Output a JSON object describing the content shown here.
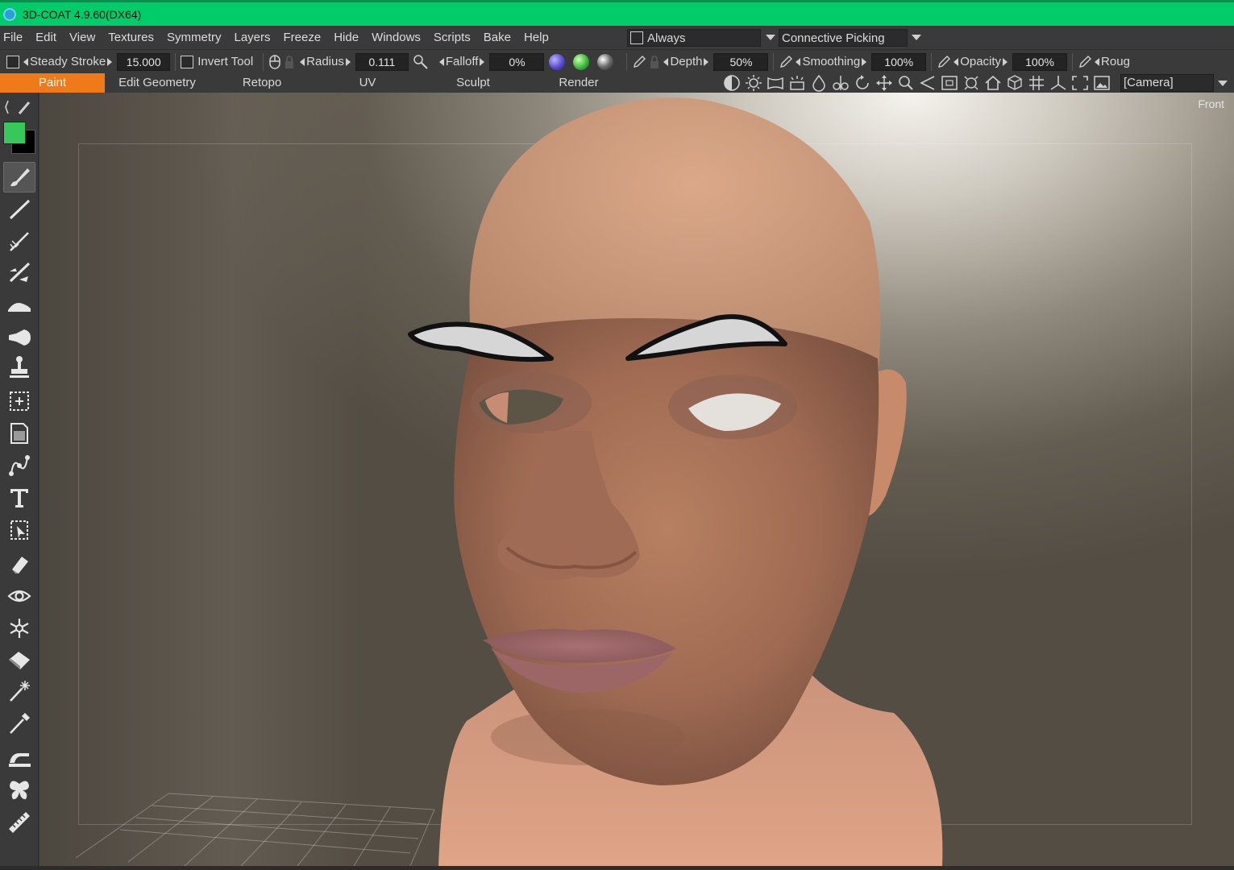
{
  "app": {
    "title": "3D-COAT 4.9.60(DX64)",
    "title_bar_color": "#00cc6a"
  },
  "menu": {
    "items": [
      "File",
      "Edit",
      "View",
      "Textures",
      "Symmetry",
      "Layers",
      "Freeze",
      "Hide",
      "Windows",
      "Scripts",
      "Bake",
      "Help"
    ],
    "always_label": "Always",
    "picking_label": "Connective  Picking"
  },
  "toolbar": {
    "steady_stroke_label": "Steady  Stroke",
    "steady_stroke_value": "15.000",
    "invert_tool_label": "Invert  Tool",
    "radius_label": "Radius",
    "radius_value": "0.111",
    "falloff_label": "Falloff",
    "falloff_value": "0%",
    "depth_label": "Depth",
    "depth_value": "50%",
    "smoothing_label": "Smoothing",
    "smoothing_value": "100%",
    "opacity_label": "Opacity",
    "opacity_value": "100%",
    "roughness_label": "Roug"
  },
  "rooms": {
    "tabs": [
      "Paint",
      "Edit  Geometry",
      "Retopo",
      "UV",
      "Sculpt",
      "Render"
    ],
    "active": "Paint",
    "active_color": "#f07a1a",
    "camera_label": "[Camera]"
  },
  "colors": {
    "primary": "#36c95a",
    "secondary": "#000000"
  },
  "viewport": {
    "view_label": "Front"
  },
  "tools": [
    "select-arrow-icon",
    "brush-icon",
    "line-icon",
    "spline-brush-icon",
    "fill-brush-icon",
    "smudge-icon",
    "blur-icon",
    "stamp-icon",
    "frame-icon",
    "page-icon",
    "curve-icon",
    "text-icon",
    "select-frame-icon",
    "eraser-icon",
    "eye-icon",
    "freeze-icon",
    "bucket-icon",
    "magic-wand-icon",
    "eyedropper-icon",
    "iron-icon",
    "symmetry-icon",
    "ruler-icon"
  ]
}
